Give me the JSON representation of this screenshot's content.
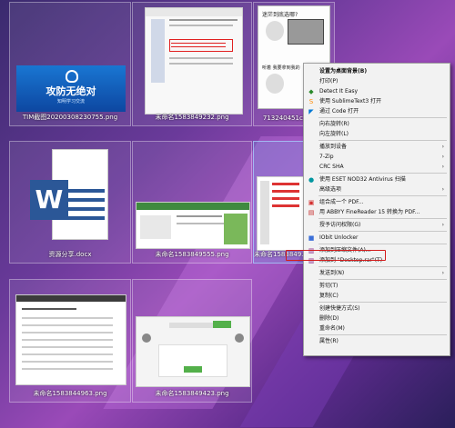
{
  "tiles": [
    {
      "name": "TIM截图20200308230755.png",
      "selected": false
    },
    {
      "name": "未命名1583849232.png",
      "selected": false
    },
    {
      "name": "713240451c3a.png",
      "selected": false
    },
    {
      "name": "资源分享.docx",
      "selected": false
    },
    {
      "name": "未命名1583849555.png",
      "selected": false
    },
    {
      "name": "未命名1583849...",
      "selected": true
    },
    {
      "name": "未命名1583844963.png",
      "selected": false
    },
    {
      "name": "未命名1583849423.png",
      "selected": false
    }
  ],
  "thumbs": {
    "banner_text": "攻防无绝对",
    "banner_sub": "知明学习交流",
    "meme_top": "迷茫到底选哪?",
    "meme_bottom": "听着 我要拿到我的"
  },
  "menu": {
    "items": [
      {
        "label": "设置为桌面背景(B)",
        "bold": true,
        "icon": "",
        "arrow": false
      },
      {
        "label": "打印(P)",
        "icon": "",
        "arrow": false
      },
      {
        "label": "Detect It Easy",
        "icon": "die-icon",
        "arrow": false
      },
      {
        "label": "使用 SublimeText3 打开",
        "icon": "sublime-icon",
        "arrow": false
      },
      {
        "label": "通过 Code 打开",
        "icon": "vscode-icon",
        "arrow": false
      },
      {
        "sep": true
      },
      {
        "label": "向右旋转(R)",
        "icon": "",
        "arrow": false
      },
      {
        "label": "向左旋转(L)",
        "icon": "",
        "arrow": false
      },
      {
        "sep": true
      },
      {
        "label": "播放到设备",
        "icon": "",
        "arrow": true
      },
      {
        "label": "7-Zip",
        "icon": "",
        "arrow": true
      },
      {
        "label": "CRC SHA",
        "icon": "",
        "arrow": true
      },
      {
        "sep": true
      },
      {
        "label": "使用 ESET NOD32 Antivirus 扫描",
        "icon": "eset-icon",
        "arrow": false
      },
      {
        "label": "高级选项",
        "icon": "",
        "arrow": true
      },
      {
        "sep": true
      },
      {
        "label": "组合成一个 PDF...",
        "icon": "pdf-icon",
        "arrow": false
      },
      {
        "label": "用 ABBYY FineReader 15 转换为 PDF...",
        "icon": "abbyy-icon",
        "arrow": false
      },
      {
        "sep": true
      },
      {
        "label": "授予访问权限(G)",
        "icon": "",
        "arrow": true
      },
      {
        "sep": true
      },
      {
        "label": "IObit Unlocker",
        "icon": "iobit-icon",
        "arrow": false
      },
      {
        "sep": true
      },
      {
        "label": "添加到压缩文件(A)...",
        "icon": "rar-icon",
        "arrow": false
      },
      {
        "label": "添加到 \"Desktop.rar\"(T)",
        "icon": "rar-icon",
        "arrow": false
      },
      {
        "sep": true
      },
      {
        "label": "发送到(N)",
        "icon": "",
        "arrow": true
      },
      {
        "sep": true
      },
      {
        "label": "剪切(T)",
        "icon": "",
        "arrow": false
      },
      {
        "label": "复制(C)",
        "icon": "",
        "arrow": false
      },
      {
        "sep": true
      },
      {
        "label": "创建快捷方式(S)",
        "icon": "",
        "arrow": false
      },
      {
        "label": "删除(D)",
        "icon": "",
        "arrow": false
      },
      {
        "label": "重命名(M)",
        "icon": "",
        "arrow": false
      },
      {
        "sep": true
      },
      {
        "label": "属性(R)",
        "icon": "",
        "arrow": false
      }
    ]
  },
  "colors": {
    "highlight": "#d21c1c",
    "banner": "#1565c0",
    "word": "#2b5797"
  }
}
